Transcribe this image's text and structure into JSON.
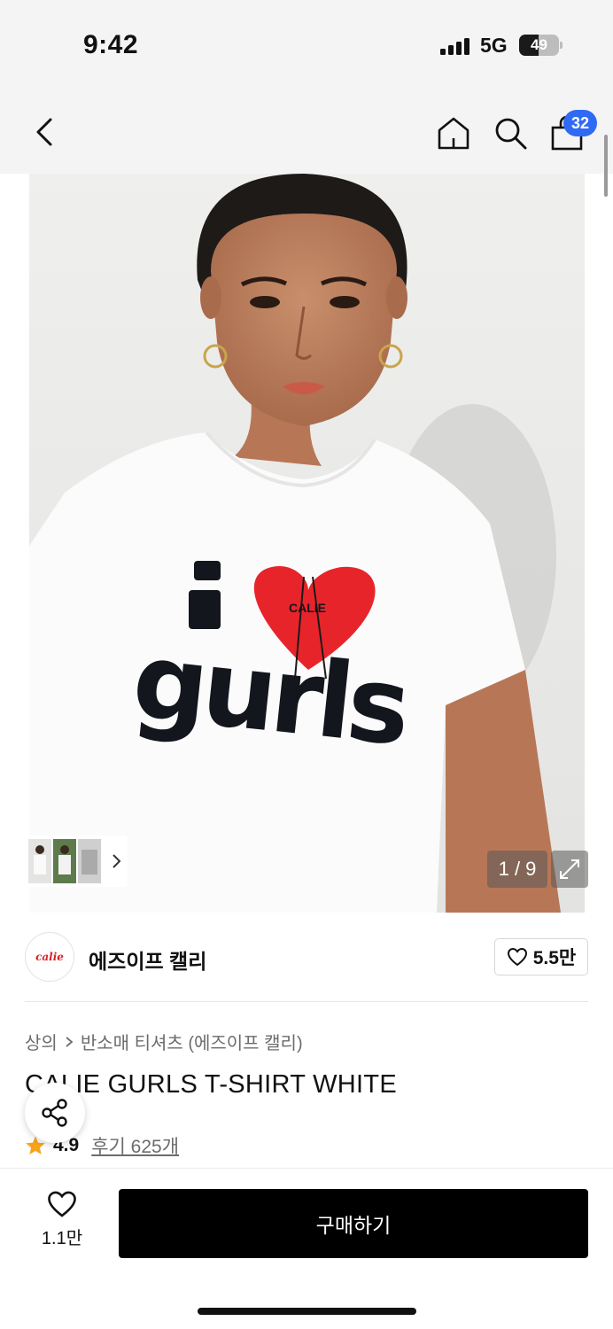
{
  "status_bar": {
    "time": "9:42",
    "network": "5G",
    "battery": "49",
    "battery_level": 0.49
  },
  "nav": {
    "cart_count": "32"
  },
  "gallery": {
    "page_counter": "1 / 9",
    "shirt_print_line1": "i",
    "shirt_print_line2": "gurls",
    "shirt_ribbon_text": "CALIE"
  },
  "brand": {
    "logo_text": "calie",
    "name": "에즈이프 캘리",
    "likes": "5.5만"
  },
  "breadcrumb": {
    "category": "상의",
    "subcategory": "반소매 티셔츠 (에즈이프 캘리)"
  },
  "product": {
    "title": "CALIE GURLS T-SHIRT WHITE",
    "rating": "4.9",
    "reviews": "후기 625개"
  },
  "bottom_bar": {
    "wish_count": "1.1만",
    "buy_label": "구매하기"
  },
  "colors": {
    "accent_badge": "#2f6af5",
    "heart_red": "#e8242b",
    "buy_button": "#000000",
    "rating_star": "#f7a31c"
  },
  "icons": [
    "back-arrow-icon",
    "home-icon",
    "search-icon",
    "shopping-bag-icon",
    "chevron-right-icon",
    "expand-icon",
    "heart-outline-icon",
    "share-icon",
    "star-icon"
  ]
}
